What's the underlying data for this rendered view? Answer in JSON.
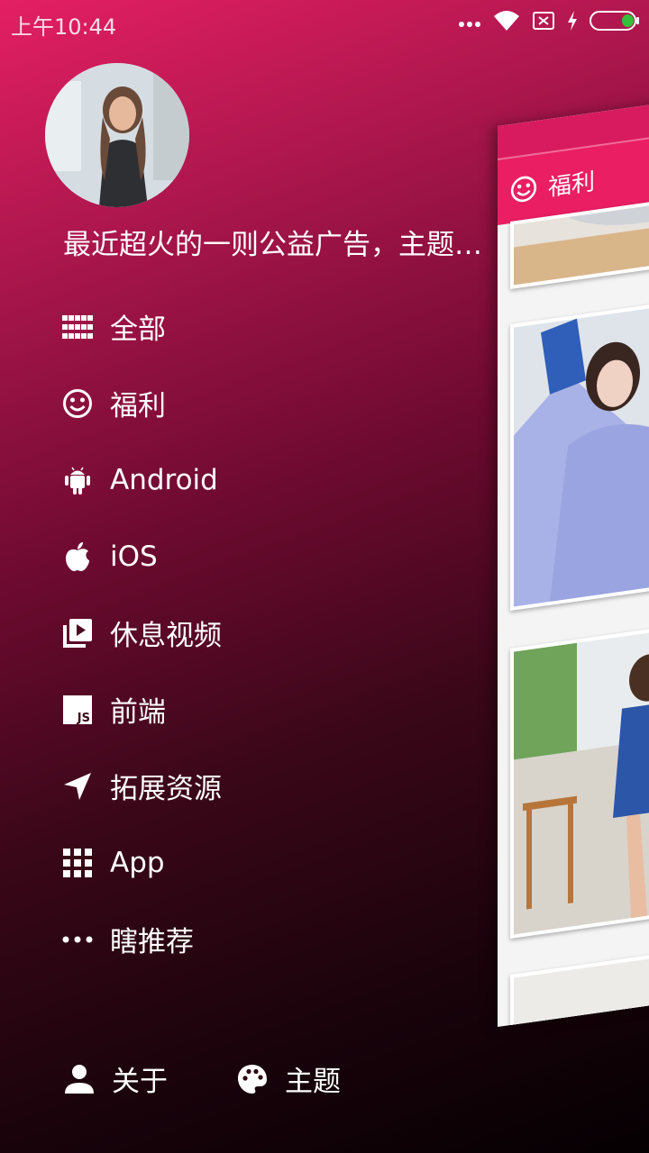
{
  "status_bar": {
    "time": "上午10:44",
    "icons": [
      "more-dots-icon",
      "wifi-icon",
      "sim-off-icon",
      "charging-icon",
      "battery-icon"
    ]
  },
  "drawer": {
    "profile_text": "最近超火的一则公益广告，主题…",
    "menu": [
      {
        "label": "全部",
        "icon": "grid-icon"
      },
      {
        "label": "福利",
        "icon": "smile-icon"
      },
      {
        "label": "Android",
        "icon": "android-icon"
      },
      {
        "label": "iOS",
        "icon": "apple-icon"
      },
      {
        "label": "休息视频",
        "icon": "video-library-icon"
      },
      {
        "label": "前端",
        "icon": "js-icon"
      },
      {
        "label": "拓展资源",
        "icon": "navigation-arrow-icon"
      },
      {
        "label": "App",
        "icon": "apps-icon"
      },
      {
        "label": "瞎推荐",
        "icon": "more-horiz-icon"
      }
    ],
    "bottom": [
      {
        "label": "关于",
        "icon": "person-icon"
      },
      {
        "label": "主题",
        "icon": "palette-icon"
      }
    ]
  },
  "content": {
    "toolbar_title": "福利",
    "toolbar_icon": "smile-icon"
  },
  "colors": {
    "accent": "#e91e63",
    "background_dark": "#050002"
  }
}
